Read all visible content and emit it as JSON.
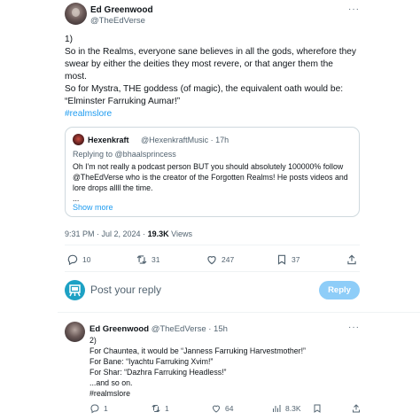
{
  "main_tweet": {
    "author_name": "Ed Greenwood",
    "author_handle": "@TheEdVerse",
    "more_label": "···",
    "lines": [
      "1)",
      "So in the Realms, everyone sane believes in all the gods, wherefore they",
      "swear by either the deities they most revere, or that anger them the",
      "most.",
      "So for Mystra, THE goddess (of magic), the equivalent oath would be:",
      "“Elminster Farruking Aumar!”"
    ],
    "hashtag": "#realmslore",
    "timestamp": "9:31 PM · Jul 2, 2024 ·",
    "views_count": "19.3K",
    "views_label": "Views",
    "actions": {
      "replies": "10",
      "reposts": "31",
      "likes": "247",
      "bookmarks": "37"
    }
  },
  "quoted_tweet": {
    "author_name": "Hexenkraft",
    "author_meta": "@HexenkraftMusic · 17h",
    "replying_prefix": "Replying to",
    "replying_to": "@bhaalsprincess",
    "lines": [
      "Oh I'm not really a podcast person BUT you should absolutely 100000% follow",
      "@TheEdVerse who is the creator of the Forgotten Realms! He posts videos and",
      "lore drops allll the time.",
      "..."
    ],
    "show_more": "Show more"
  },
  "composer": {
    "placeholder": "Post your reply",
    "reply_button": "Reply"
  },
  "reply_tweet": {
    "author_name": "Ed Greenwood",
    "author_meta": "@TheEdVerse · 15h",
    "more_label": "···",
    "lines": [
      "2)",
      "For Chauntea, it would be “Janness Farruking Harvestmother!”",
      "For Bane: “Iyachtu Farruking Xvim!”",
      "For Shar: “Dazhra Farruking Headless!”",
      "...and so on."
    ],
    "hashtag": "#realmslore",
    "actions": {
      "replies": "1",
      "reposts": "1",
      "likes": "64",
      "views": "8.3K"
    }
  },
  "colors": {
    "accent": "#1d9bf0",
    "secondary_text": "#536471",
    "border": "#cfd9de",
    "reply_button_disabled": "#8ecdf8"
  }
}
